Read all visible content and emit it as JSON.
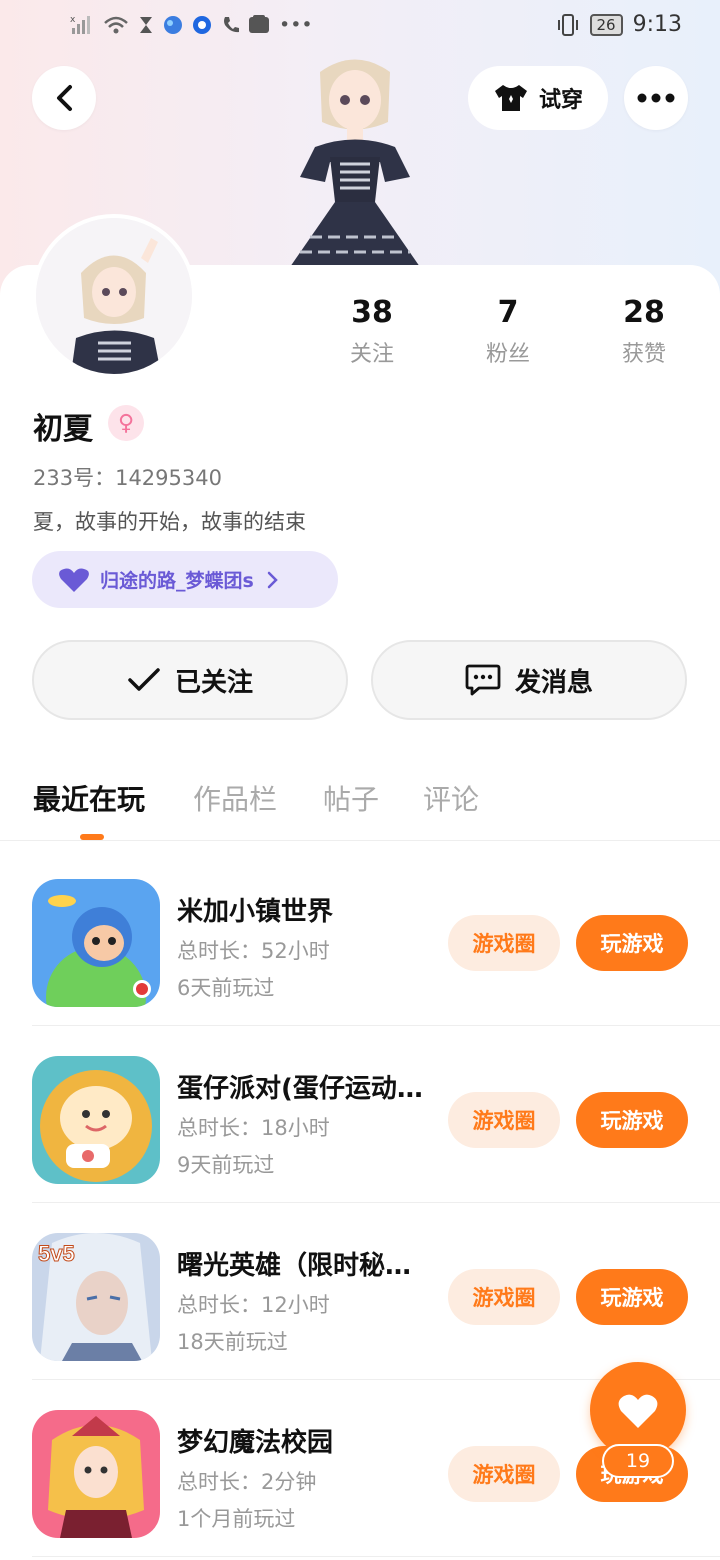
{
  "status_bar": {
    "left_icons": [
      "signal-x-icon",
      "wifi-icon",
      "hourglass-icon",
      "globe-icon",
      "app-icon",
      "phone-icon",
      "huawei-icon",
      "more-dots-icon"
    ],
    "battery": "26",
    "time": "9:13"
  },
  "header": {
    "tryon_label": "试穿"
  },
  "profile": {
    "stats": [
      {
        "value": "38",
        "label": "关注"
      },
      {
        "value": "7",
        "label": "粉丝"
      },
      {
        "value": "28",
        "label": "获赞"
      }
    ],
    "name": "初夏",
    "uid_text": "233号：14295340",
    "bio": "夏，故事的开始，故事的结束",
    "group_label": "归途的路_梦蝶团s"
  },
  "actions": {
    "follow_label": "已关注",
    "message_label": "发消息"
  },
  "tabs": [
    {
      "label": "最近在玩",
      "active": true
    },
    {
      "label": "作品栏",
      "active": false
    },
    {
      "label": "帖子",
      "active": false
    },
    {
      "label": "评论",
      "active": false
    }
  ],
  "games": [
    {
      "title": "米加小镇世界",
      "playtime": "总时长：52小时",
      "last_played": "6天前玩过",
      "circle_label": "游戏圈",
      "play_label": "玩游戏"
    },
    {
      "title": "蛋仔派对(蛋仔运动…",
      "playtime": "总时长：18小时",
      "last_played": "9天前玩过",
      "circle_label": "游戏圈",
      "play_label": "玩游戏"
    },
    {
      "title": "曙光英雄（限时秘…",
      "playtime": "总时长：12小时",
      "last_played": "18天前玩过",
      "circle_label": "游戏圈",
      "play_label": "玩游戏"
    },
    {
      "title": "梦幻魔法校园",
      "playtime": "总时长：2分钟",
      "last_played": "1个月前玩过",
      "circle_label": "游戏圈",
      "play_label": "玩游戏"
    }
  ],
  "game_icon_badge": "5v5",
  "floating_like": {
    "count": "19"
  },
  "colors": {
    "accent": "#ff7a1a",
    "accent_light": "#fdece0",
    "group_pill": "#ebe8fb",
    "group_text": "#6a5ad6"
  }
}
